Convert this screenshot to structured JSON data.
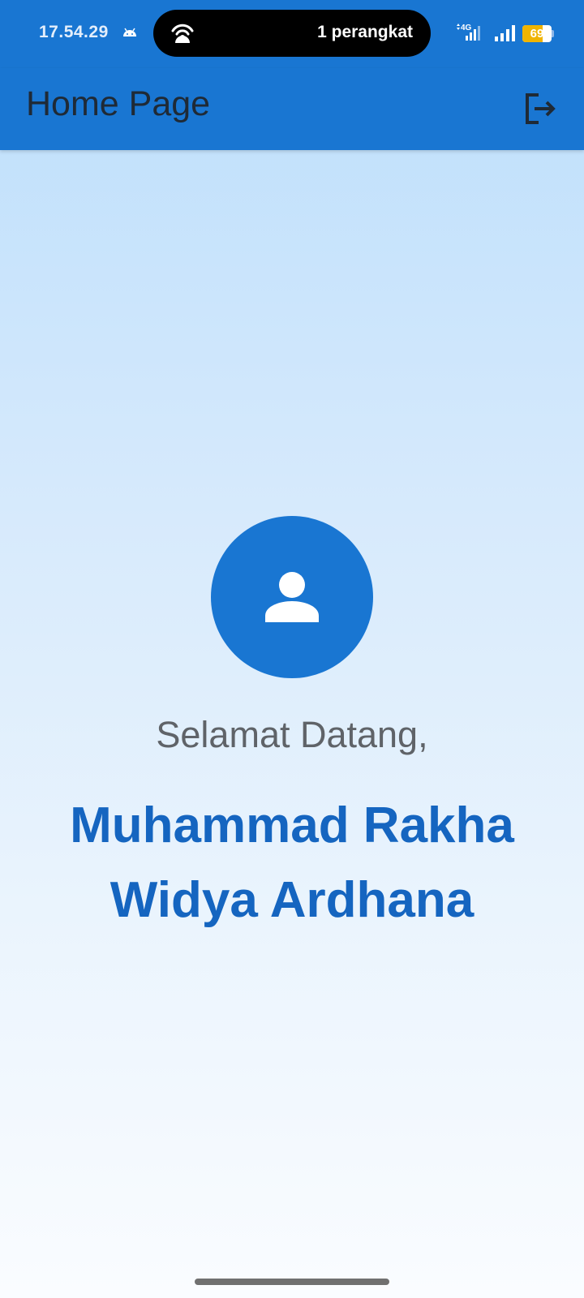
{
  "status_bar": {
    "time": "17.54.29",
    "android_icon": "android-debug-icon",
    "hotspot_icon": "hotspot-icon",
    "hotspot_text": "1 perangkat",
    "network_label": "4G",
    "battery_level": "69",
    "battery_fraction": 0.69
  },
  "app_bar": {
    "title": "Home Page",
    "logout_icon": "logout-icon"
  },
  "main": {
    "avatar_icon": "person-icon",
    "welcome": "Selamat Datang,",
    "user_name": "Muhammad Rakha Widya Ardhana"
  },
  "colors": {
    "primary": "#1976d2",
    "name_text": "#1565c0",
    "welcome_text": "#5f6368",
    "battery": "#f0b400"
  }
}
